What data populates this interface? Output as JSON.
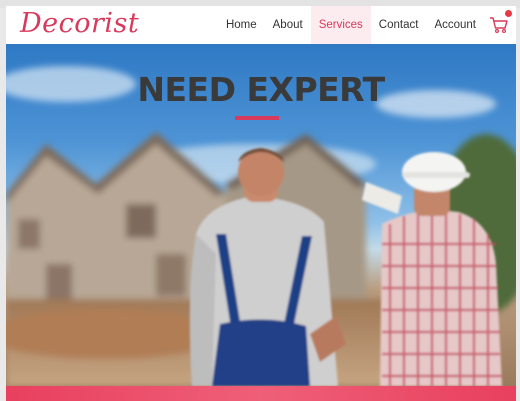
{
  "brand": {
    "logo_text": "Decorist",
    "accent_color": "#d83a5c"
  },
  "nav": {
    "items": [
      {
        "label": "Home",
        "active": false
      },
      {
        "label": "About",
        "active": false
      },
      {
        "label": "Services",
        "active": true
      },
      {
        "label": "Contact",
        "active": false
      },
      {
        "label": "Account",
        "active": false
      }
    ],
    "cart_icon": "shopping-cart-icon"
  },
  "hero": {
    "title": "NEED EXPERT",
    "image": "two-workers-viewing-house-construction"
  }
}
